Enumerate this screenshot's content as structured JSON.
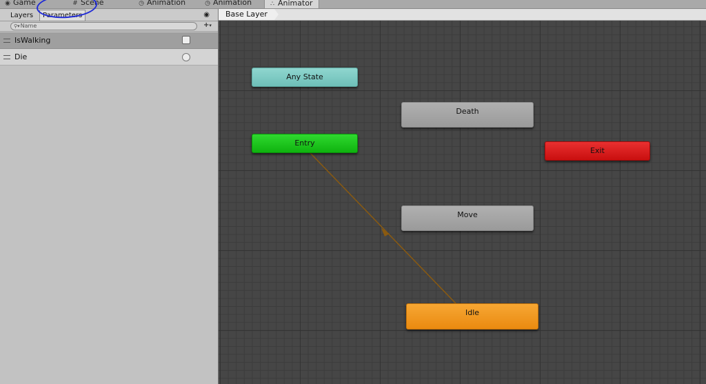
{
  "window_tabs": [
    {
      "icon": "gamepad-icon",
      "label": "Game"
    },
    {
      "icon": "grid-icon",
      "label": "Scene"
    },
    {
      "icon": "clock-icon",
      "label": "Animation"
    },
    {
      "icon": "clock-icon",
      "label": "Animation"
    },
    {
      "icon": "animator-icon",
      "label": "Animator"
    }
  ],
  "left_panel": {
    "tabs": {
      "layers": "Layers",
      "parameters": "Parameters"
    },
    "search": {
      "placeholder": "Name"
    },
    "parameters": [
      {
        "name": "IsWalking",
        "type": "bool"
      },
      {
        "name": "Die",
        "type": "trigger"
      }
    ]
  },
  "graph": {
    "breadcrumb": "Base Layer",
    "states": {
      "any_state": "Any State",
      "entry": "Entry",
      "death": "Death",
      "exit": "Exit",
      "move": "Move",
      "idle": "Idle"
    }
  },
  "colors": {
    "any_state": "#7ccac3",
    "entry": "#1ec81e",
    "exit": "#d81e1e",
    "idle": "#f0951f",
    "default_state": "#a5a5a5",
    "transition": "#8a5a10",
    "annotation": "#1f2ad6"
  }
}
